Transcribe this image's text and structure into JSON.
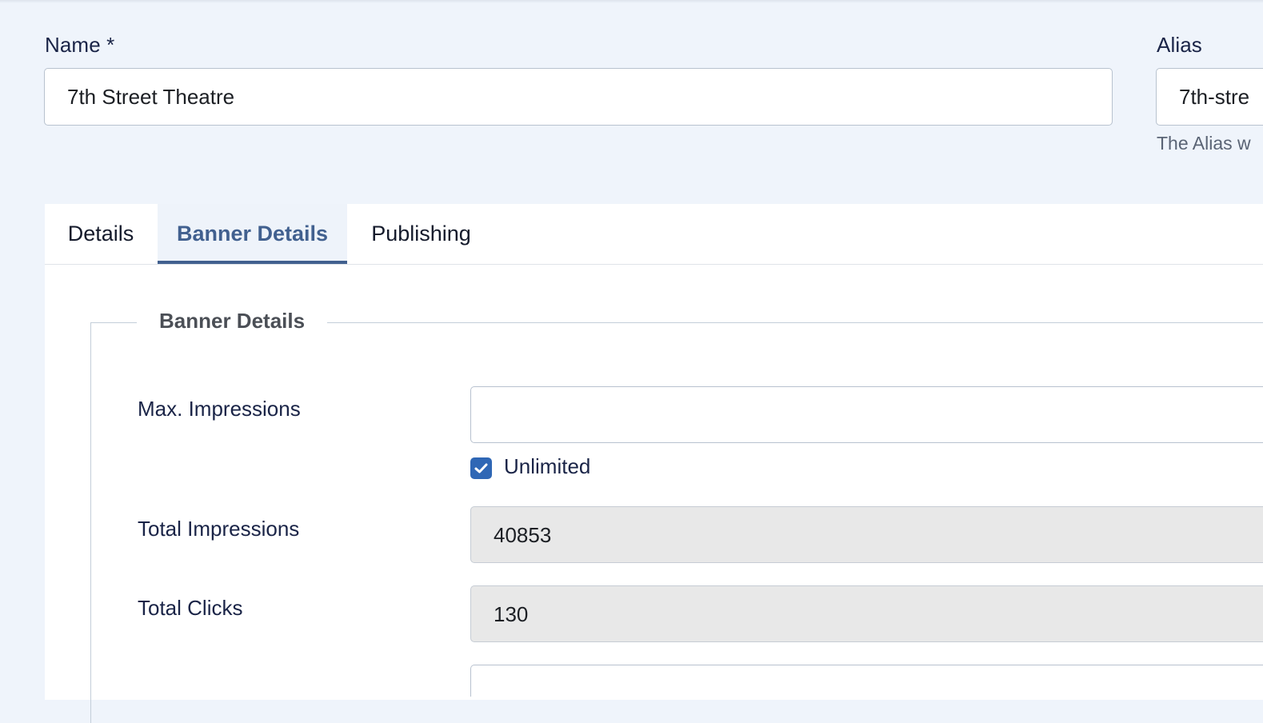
{
  "form": {
    "name_label": "Name *",
    "name_value": "7th Street Theatre",
    "alias_label": "Alias",
    "alias_value": "7th-stre",
    "alias_hint": "The Alias w"
  },
  "tabs": [
    {
      "label": "Details",
      "active": false
    },
    {
      "label": "Banner Details",
      "active": true
    },
    {
      "label": "Publishing",
      "active": false
    }
  ],
  "banner_details": {
    "legend": "Banner Details",
    "max_impressions_label": "Max. Impressions",
    "max_impressions_value": "",
    "unlimited_label": "Unlimited",
    "unlimited_checked": true,
    "total_impressions_label": "Total Impressions",
    "total_impressions_value": "40853",
    "total_clicks_label": "Total Clicks",
    "total_clicks_value": "130"
  },
  "colors": {
    "page_background": "#eff4fb",
    "accent": "#41608f",
    "checkbox": "#2f67b5",
    "readonly_background": "#e8e8e8"
  },
  "icons": {
    "checkbox": "check-icon"
  }
}
